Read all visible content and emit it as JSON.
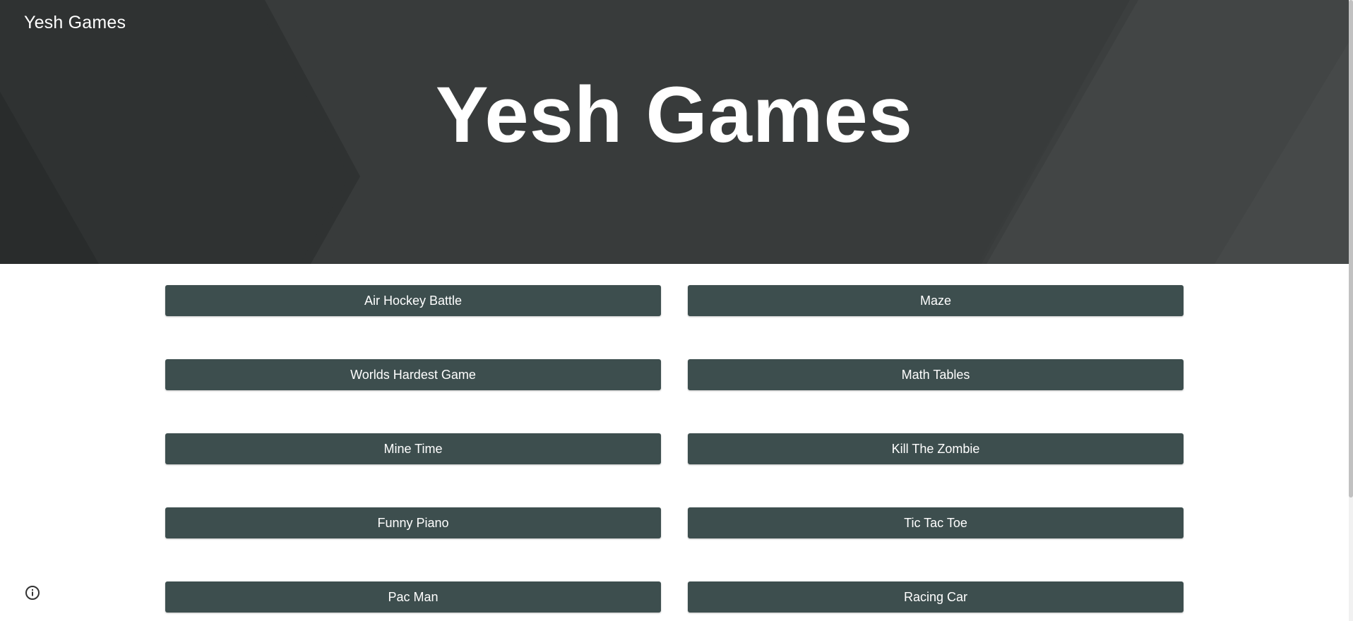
{
  "site": {
    "name": "Yesh Games"
  },
  "hero": {
    "title": "Yesh Games",
    "background_color": "#383b3b"
  },
  "games": [
    {
      "label": "Air Hockey Battle"
    },
    {
      "label": "Maze"
    },
    {
      "label": "Worlds Hardest Game"
    },
    {
      "label": "Math Tables"
    },
    {
      "label": "Mine Time"
    },
    {
      "label": "Kill The Zombie"
    },
    {
      "label": "Funny Piano"
    },
    {
      "label": "Tic Tac Toe"
    },
    {
      "label": "Pac Man"
    },
    {
      "label": "Racing Car"
    }
  ],
  "colors": {
    "button_bg": "#3d4e4e",
    "button_text": "#ffffff"
  },
  "icons": {
    "info": "info-icon"
  }
}
